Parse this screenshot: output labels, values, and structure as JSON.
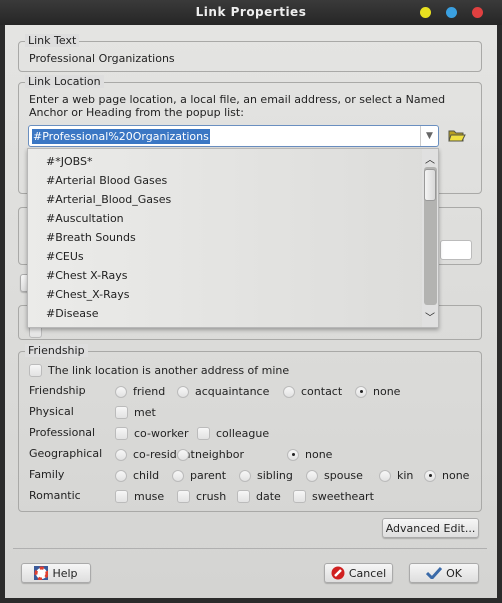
{
  "window": {
    "title": "Link Properties"
  },
  "link_text": {
    "legend": "Link Text",
    "value": "Professional Organizations"
  },
  "link_location": {
    "legend": "Link Location",
    "instructions_line1": "Enter a web page location, a local file, an email address, or select a Named",
    "instructions_line2": "Anchor or Heading from the popup list:",
    "value": "#Professional%20Organizations"
  },
  "popup": {
    "items": [
      "#*JOBS*",
      "#Arterial Blood Gases",
      "#Arterial_Blood_Gases",
      "#Auscultation",
      "#Breath Sounds",
      "#CEUs",
      "#Chest X-Rays",
      "#Chest_X-Rays",
      "#Disease"
    ]
  },
  "friendship": {
    "legend": "Friendship",
    "another_address": "The link location is another address of mine",
    "rows": [
      {
        "label": "Friendship",
        "type": "radio",
        "options": [
          "friend",
          "acquaintance",
          "contact",
          "none"
        ],
        "selected": "none"
      },
      {
        "label": "Physical",
        "type": "check",
        "options": [
          "met"
        ]
      },
      {
        "label": "Professional",
        "type": "check",
        "options": [
          "co-worker",
          "colleague"
        ]
      },
      {
        "label": "Geographical",
        "type": "radio",
        "options": [
          "co-resident",
          "neighbor",
          "none"
        ],
        "selected": "none"
      },
      {
        "label": "Family",
        "type": "radio",
        "options": [
          "child",
          "parent",
          "sibling",
          "spouse",
          "kin",
          "none"
        ],
        "selected": "none"
      },
      {
        "label": "Romantic",
        "type": "check",
        "options": [
          "muse",
          "crush",
          "date",
          "sweetheart"
        ]
      }
    ]
  },
  "buttons": {
    "advanced": "Advanced Edit...",
    "help": "Help",
    "cancel": "Cancel",
    "ok": "OK"
  }
}
